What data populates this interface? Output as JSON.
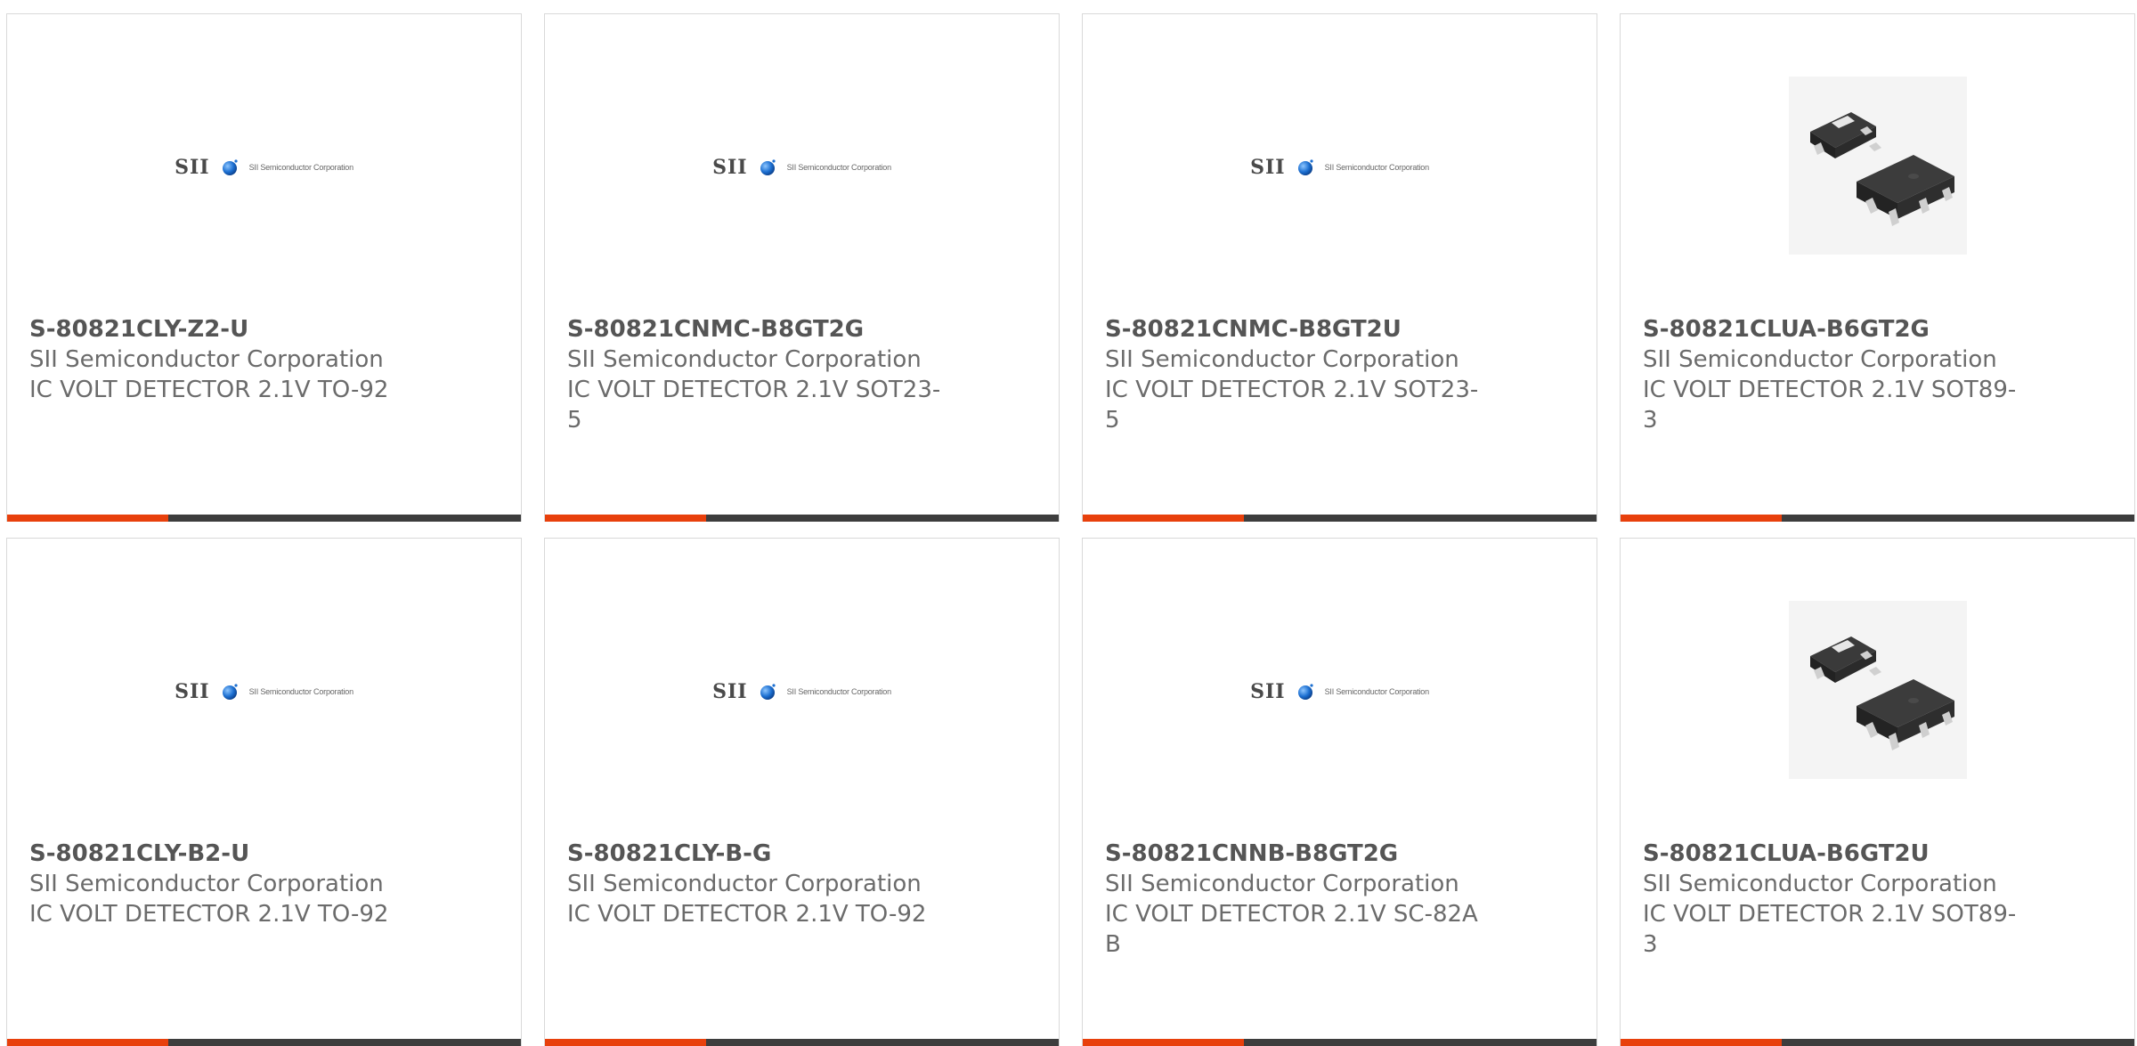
{
  "colors": {
    "accent": "#e8400c",
    "bar": "#3d3d3d",
    "border": "#d9d9d9",
    "text": "#6b6b6b",
    "part_number": "#555555"
  },
  "logo": {
    "mark": "SII",
    "tagline": "SII Semiconductor Corporation"
  },
  "products": [
    {
      "part_number": "S-80821CLY-Z2-U",
      "manufacturer": "SII Semiconductor Corporation",
      "description": "IC VOLT DETECTOR 2.1V TO-92",
      "image": "sii-logo"
    },
    {
      "part_number": "S-80821CNMC-B8GT2G",
      "manufacturer": "SII Semiconductor Corporation",
      "description": "IC VOLT DETECTOR 2.1V SOT23-5",
      "image": "sii-logo"
    },
    {
      "part_number": "S-80821CNMC-B8GT2U",
      "manufacturer": "SII Semiconductor Corporation",
      "description": "IC VOLT DETECTOR 2.1V SOT23-5",
      "image": "sii-logo"
    },
    {
      "part_number": "S-80821CLUA-B6GT2G",
      "manufacturer": "SII Semiconductor Corporation",
      "description": "IC VOLT DETECTOR 2.1V SOT89-3",
      "image": "sot89-package"
    },
    {
      "part_number": "S-80821CLY-B2-U",
      "manufacturer": "SII Semiconductor Corporation",
      "description": "IC VOLT DETECTOR 2.1V TO-92",
      "image": "sii-logo"
    },
    {
      "part_number": "S-80821CLY-B-G",
      "manufacturer": "SII Semiconductor Corporation",
      "description": "IC VOLT DETECTOR 2.1V TO-92",
      "image": "sii-logo"
    },
    {
      "part_number": "S-80821CNNB-B8GT2G",
      "manufacturer": "SII Semiconductor Corporation",
      "description": "IC VOLT DETECTOR 2.1V SC-82AB",
      "image": "sii-logo"
    },
    {
      "part_number": "S-80821CLUA-B6GT2U",
      "manufacturer": "SII Semiconductor Corporation",
      "description": "IC VOLT DETECTOR 2.1V SOT89-3",
      "image": "sot89-package"
    }
  ]
}
